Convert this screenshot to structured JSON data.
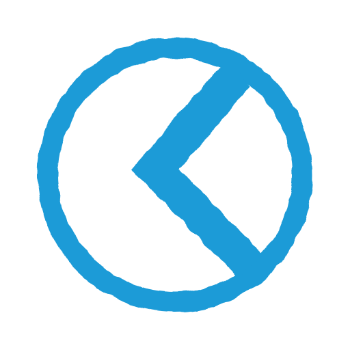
{
  "logo": {
    "icon": "chevron-left-circle-icon",
    "color": "#1e9bd7",
    "background": "#ffffff"
  }
}
